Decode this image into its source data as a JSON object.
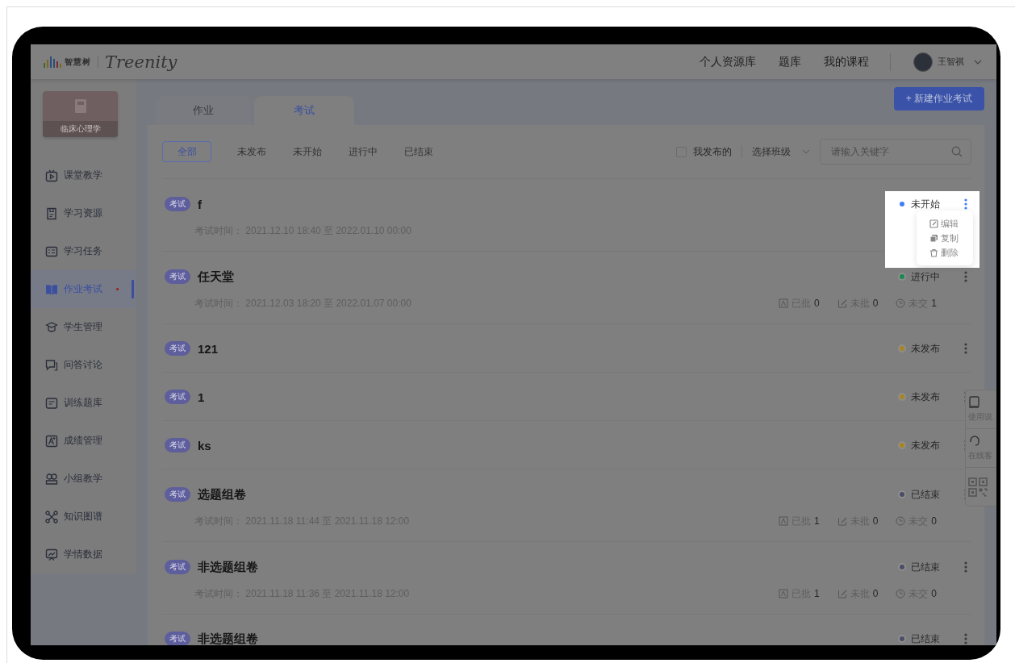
{
  "header": {
    "logo_text": "智慧树",
    "brand": "Treenity",
    "nav": [
      {
        "label": "个人资源库"
      },
      {
        "label": "题库"
      },
      {
        "label": "我的课程"
      }
    ],
    "user": {
      "name": "王智祺"
    }
  },
  "sidebar": {
    "course": {
      "title": "临床心理学"
    },
    "items": [
      {
        "label": "课堂教学",
        "selected": false,
        "notify": false
      },
      {
        "label": "学习资源",
        "selected": false,
        "notify": false
      },
      {
        "label": "学习任务",
        "selected": false,
        "notify": false
      },
      {
        "label": "作业考试",
        "selected": true,
        "notify": true
      },
      {
        "label": "学生管理",
        "selected": false,
        "notify": false
      },
      {
        "label": "问答讨论",
        "selected": false,
        "notify": false
      },
      {
        "label": "训练题库",
        "selected": false,
        "notify": false
      },
      {
        "label": "成绩管理",
        "selected": false,
        "notify": false
      },
      {
        "label": "小组教学",
        "selected": false,
        "notify": false
      },
      {
        "label": "知识图谱",
        "selected": false,
        "notify": false
      },
      {
        "label": "学情数据",
        "selected": false,
        "notify": false
      }
    ]
  },
  "tabs": [
    {
      "label": "作业",
      "selected": false
    },
    {
      "label": "考试",
      "selected": true
    }
  ],
  "new_button": {
    "label": "+ 新建作业考试"
  },
  "filters": [
    {
      "label": "全部",
      "selected": true
    },
    {
      "label": "未发布",
      "selected": false
    },
    {
      "label": "未开始",
      "selected": false
    },
    {
      "label": "进行中",
      "selected": false
    },
    {
      "label": "已结束",
      "selected": false
    }
  ],
  "mine_filter": {
    "label": "我发布的",
    "checked": false
  },
  "class_select": {
    "placeholder": "选择班级"
  },
  "search": {
    "placeholder": "请输入关键字"
  },
  "items": [
    {
      "badge": "考试",
      "title": "f",
      "time": "考试时间： 2021.12.10 18:40 至 2022.01.10 00:00",
      "status": "未开始",
      "color": "#3d7ef5",
      "highlighted": true,
      "menu": [
        "编辑",
        "复制",
        "删除"
      ]
    },
    {
      "badge": "考试",
      "title": "任天堂",
      "time": "考试时间： 2021.12.03 18:20 至 2022.01.07 00:00",
      "status": "进行中",
      "color": "#1a8a50",
      "highlighted": false,
      "stats": [
        {
          "label": "已批",
          "value": "0"
        },
        {
          "label": "未批",
          "value": "0"
        },
        {
          "label": "未交",
          "value": "1"
        }
      ]
    },
    {
      "badge": "考试",
      "title": "121",
      "status": "未发布",
      "color": "#a88520",
      "highlighted": false
    },
    {
      "badge": "考试",
      "title": "1",
      "status": "未发布",
      "color": "#a88520",
      "highlighted": false
    },
    {
      "badge": "考试",
      "title": "ks",
      "status": "未发布",
      "color": "#a88520",
      "highlighted": false
    },
    {
      "badge": "考试",
      "title": "选题组卷",
      "time": "考试时间： 2021.11.18 11:44 至 2021.11.18 12:00",
      "status": "已结束",
      "color": "#4a4d66",
      "highlighted": false,
      "stats": [
        {
          "label": "已批",
          "value": "1"
        },
        {
          "label": "未批",
          "value": "0"
        },
        {
          "label": "未交",
          "value": "0"
        }
      ]
    },
    {
      "badge": "考试",
      "title": "非选题组卷",
      "time": "考试时间： 2021.11.18 11:36 至 2021.11.18 12:00",
      "status": "已结束",
      "color": "#4a4d66",
      "highlighted": false,
      "stats": [
        {
          "label": "已批",
          "value": "1"
        },
        {
          "label": "未批",
          "value": "0"
        },
        {
          "label": "未交",
          "value": "0"
        }
      ]
    },
    {
      "badge": "考试",
      "title": "非选题组卷",
      "status": "已结束",
      "color": "#4a4d66",
      "highlighted": false
    }
  ],
  "side_tools": [
    {
      "kind": "manual",
      "label": "使用说"
    },
    {
      "kind": "service",
      "label": "在线客"
    },
    {
      "kind": "qr"
    }
  ]
}
